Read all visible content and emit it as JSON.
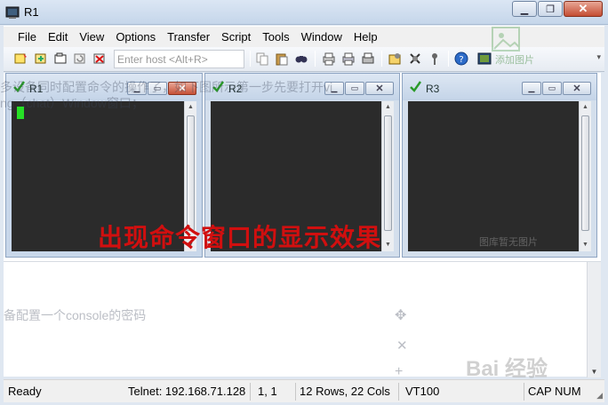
{
  "window": {
    "title": "R1"
  },
  "menu": [
    "File",
    "Edit",
    "View",
    "Options",
    "Transfer",
    "Script",
    "Tools",
    "Window",
    "Help"
  ],
  "toolbar": {
    "host_placeholder": "Enter host <Alt+R>"
  },
  "sessions": [
    {
      "name": "R1",
      "active": true
    },
    {
      "name": "R2",
      "active": false
    },
    {
      "name": "R3",
      "active": false
    }
  ],
  "annotation": "出现命令窗口的显示效果",
  "ghost_texts": {
    "line1": "多设备同时配置命令的操作了，如下图所示第一步先要打开vi",
    "line2": "ng（chat）Window窗口；",
    "line3": "备配置一个console的密码",
    "add_image": "添加图片",
    "no_image": "图库暂无图片",
    "watermark": "Bai 经验"
  },
  "status": {
    "ready": "Ready",
    "connection": "Telnet: 192.168.71.128",
    "cursor_pos": "1,   1",
    "dimensions": "12 Rows, 22 Cols",
    "terminal_type": "VT100",
    "caps": "CAP",
    "num": "NUM"
  },
  "colors": {
    "annotation": "#d10f0f",
    "cursor": "#26e026",
    "terminal_bg": "#2b2b2b"
  }
}
